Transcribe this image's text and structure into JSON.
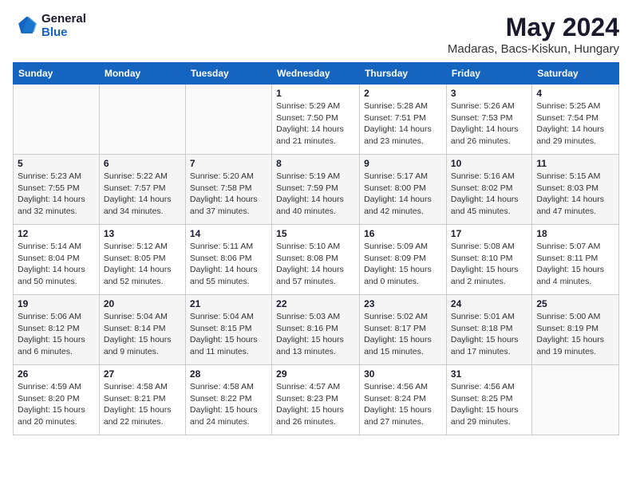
{
  "header": {
    "logo_line1": "General",
    "logo_line2": "Blue",
    "title": "May 2024",
    "subtitle": "Madaras, Bacs-Kiskun, Hungary"
  },
  "weekdays": [
    "Sunday",
    "Monday",
    "Tuesday",
    "Wednesday",
    "Thursday",
    "Friday",
    "Saturday"
  ],
  "weeks": [
    [
      {
        "day": "",
        "info": ""
      },
      {
        "day": "",
        "info": ""
      },
      {
        "day": "",
        "info": ""
      },
      {
        "day": "1",
        "info": "Sunrise: 5:29 AM\nSunset: 7:50 PM\nDaylight: 14 hours and 21 minutes."
      },
      {
        "day": "2",
        "info": "Sunrise: 5:28 AM\nSunset: 7:51 PM\nDaylight: 14 hours and 23 minutes."
      },
      {
        "day": "3",
        "info": "Sunrise: 5:26 AM\nSunset: 7:53 PM\nDaylight: 14 hours and 26 minutes."
      },
      {
        "day": "4",
        "info": "Sunrise: 5:25 AM\nSunset: 7:54 PM\nDaylight: 14 hours and 29 minutes."
      }
    ],
    [
      {
        "day": "5",
        "info": "Sunrise: 5:23 AM\nSunset: 7:55 PM\nDaylight: 14 hours and 32 minutes."
      },
      {
        "day": "6",
        "info": "Sunrise: 5:22 AM\nSunset: 7:57 PM\nDaylight: 14 hours and 34 minutes."
      },
      {
        "day": "7",
        "info": "Sunrise: 5:20 AM\nSunset: 7:58 PM\nDaylight: 14 hours and 37 minutes."
      },
      {
        "day": "8",
        "info": "Sunrise: 5:19 AM\nSunset: 7:59 PM\nDaylight: 14 hours and 40 minutes."
      },
      {
        "day": "9",
        "info": "Sunrise: 5:17 AM\nSunset: 8:00 PM\nDaylight: 14 hours and 42 minutes."
      },
      {
        "day": "10",
        "info": "Sunrise: 5:16 AM\nSunset: 8:02 PM\nDaylight: 14 hours and 45 minutes."
      },
      {
        "day": "11",
        "info": "Sunrise: 5:15 AM\nSunset: 8:03 PM\nDaylight: 14 hours and 47 minutes."
      }
    ],
    [
      {
        "day": "12",
        "info": "Sunrise: 5:14 AM\nSunset: 8:04 PM\nDaylight: 14 hours and 50 minutes."
      },
      {
        "day": "13",
        "info": "Sunrise: 5:12 AM\nSunset: 8:05 PM\nDaylight: 14 hours and 52 minutes."
      },
      {
        "day": "14",
        "info": "Sunrise: 5:11 AM\nSunset: 8:06 PM\nDaylight: 14 hours and 55 minutes."
      },
      {
        "day": "15",
        "info": "Sunrise: 5:10 AM\nSunset: 8:08 PM\nDaylight: 14 hours and 57 minutes."
      },
      {
        "day": "16",
        "info": "Sunrise: 5:09 AM\nSunset: 8:09 PM\nDaylight: 15 hours and 0 minutes."
      },
      {
        "day": "17",
        "info": "Sunrise: 5:08 AM\nSunset: 8:10 PM\nDaylight: 15 hours and 2 minutes."
      },
      {
        "day": "18",
        "info": "Sunrise: 5:07 AM\nSunset: 8:11 PM\nDaylight: 15 hours and 4 minutes."
      }
    ],
    [
      {
        "day": "19",
        "info": "Sunrise: 5:06 AM\nSunset: 8:12 PM\nDaylight: 15 hours and 6 minutes."
      },
      {
        "day": "20",
        "info": "Sunrise: 5:04 AM\nSunset: 8:14 PM\nDaylight: 15 hours and 9 minutes."
      },
      {
        "day": "21",
        "info": "Sunrise: 5:04 AM\nSunset: 8:15 PM\nDaylight: 15 hours and 11 minutes."
      },
      {
        "day": "22",
        "info": "Sunrise: 5:03 AM\nSunset: 8:16 PM\nDaylight: 15 hours and 13 minutes."
      },
      {
        "day": "23",
        "info": "Sunrise: 5:02 AM\nSunset: 8:17 PM\nDaylight: 15 hours and 15 minutes."
      },
      {
        "day": "24",
        "info": "Sunrise: 5:01 AM\nSunset: 8:18 PM\nDaylight: 15 hours and 17 minutes."
      },
      {
        "day": "25",
        "info": "Sunrise: 5:00 AM\nSunset: 8:19 PM\nDaylight: 15 hours and 19 minutes."
      }
    ],
    [
      {
        "day": "26",
        "info": "Sunrise: 4:59 AM\nSunset: 8:20 PM\nDaylight: 15 hours and 20 minutes."
      },
      {
        "day": "27",
        "info": "Sunrise: 4:58 AM\nSunset: 8:21 PM\nDaylight: 15 hours and 22 minutes."
      },
      {
        "day": "28",
        "info": "Sunrise: 4:58 AM\nSunset: 8:22 PM\nDaylight: 15 hours and 24 minutes."
      },
      {
        "day": "29",
        "info": "Sunrise: 4:57 AM\nSunset: 8:23 PM\nDaylight: 15 hours and 26 minutes."
      },
      {
        "day": "30",
        "info": "Sunrise: 4:56 AM\nSunset: 8:24 PM\nDaylight: 15 hours and 27 minutes."
      },
      {
        "day": "31",
        "info": "Sunrise: 4:56 AM\nSunset: 8:25 PM\nDaylight: 15 hours and 29 minutes."
      },
      {
        "day": "",
        "info": ""
      }
    ]
  ]
}
